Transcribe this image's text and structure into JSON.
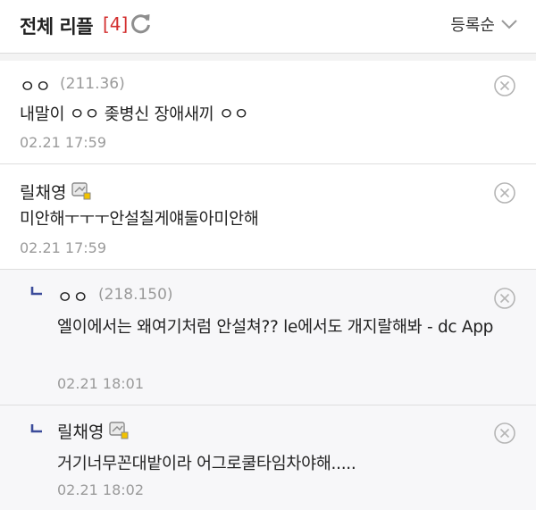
{
  "header": {
    "title": "전체 리플",
    "count": "[4]",
    "sort_label": "등록순"
  },
  "comments": [
    {
      "name": "ㅇㅇ",
      "ip": "(211.36)",
      "body": "내말이 ㅇㅇ 좆병신 장애새끼 ㅇㅇ",
      "time": "02.21 17:59"
    },
    {
      "name": "릴채영",
      "body": "미안해ㅜㅜㅜ안설칠게얘둘아미안해",
      "time": "02.21 17:59"
    },
    {
      "name": "ㅇㅇ",
      "ip": "(218.150)",
      "body": "엘이에서는 왜여기처럼 안설쳐?? le에서도 개지랄해봐 - dc App",
      "time": "02.21 18:01"
    },
    {
      "name": "릴채영",
      "body": "거기너무꼰대밭이라 어그로쿨타임차야해.....",
      "time": "02.21 18:02"
    }
  ],
  "colors": {
    "count_red": "#d32f2f",
    "reply_mark_blue": "#3b4b9a",
    "muted_gray": "#9a9a9a"
  },
  "icons": {
    "refresh": "refresh-icon",
    "sort": "chevron-down-icon",
    "delete": "close-circle-icon",
    "reply": "reply-arrow-icon",
    "fixed_nick": "fixed-nick-badge-icon"
  }
}
